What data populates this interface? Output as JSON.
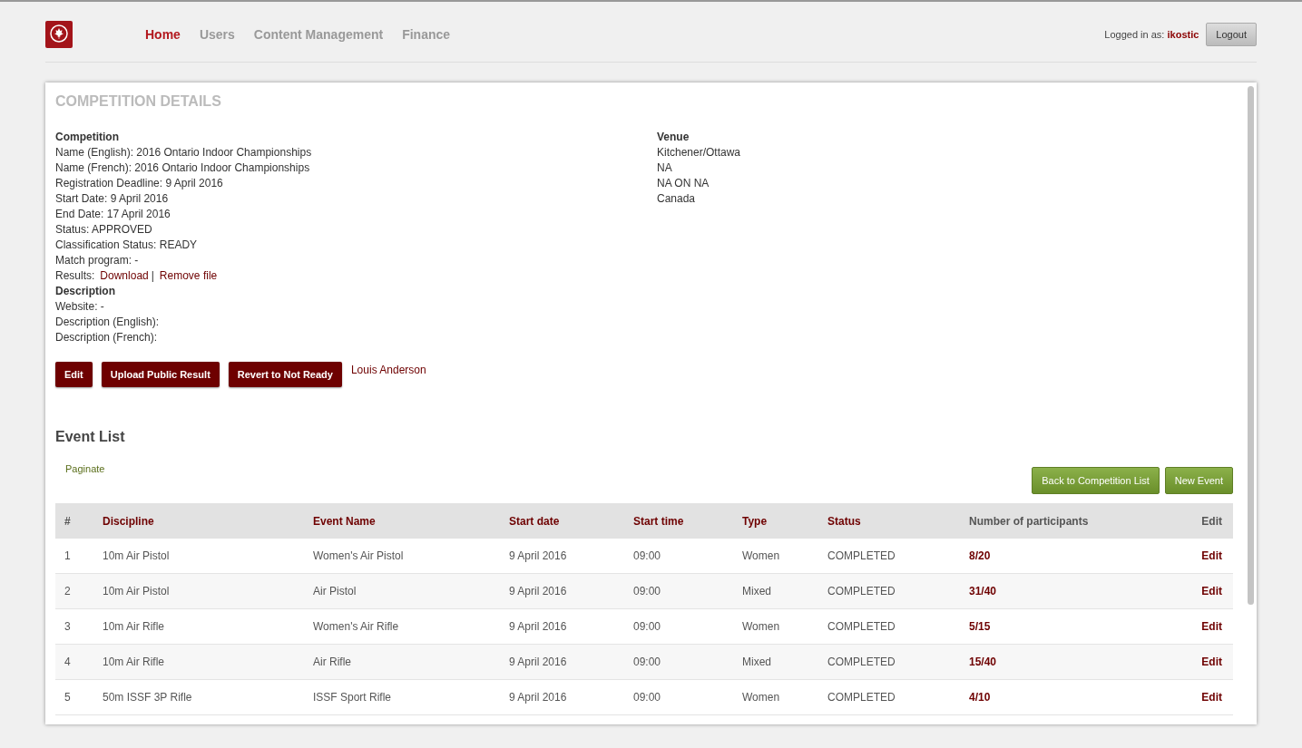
{
  "nav": [
    {
      "label": "Home",
      "selected": true
    },
    {
      "label": "Users",
      "selected": false
    },
    {
      "label": "Content Management",
      "selected": false
    },
    {
      "label": "Finance",
      "selected": false
    }
  ],
  "user": {
    "prefix": "Logged in as:",
    "name": "ikostic",
    "logout": "Logout"
  },
  "panel_title": "COMPETITION DETAILS",
  "details": [
    {
      "kind": "heading",
      "text": "Competition"
    },
    {
      "kind": "line",
      "text": "Name (English): 2016 Ontario Indoor Championships"
    },
    {
      "kind": "line",
      "text": "Name (French): 2016 Ontario Indoor Championships"
    },
    {
      "kind": "line",
      "text": "Registration Deadline: 9 April 2016"
    },
    {
      "kind": "line",
      "text": "Start Date: 9 April 2016"
    },
    {
      "kind": "line",
      "text": "End Date: 17 April 2016"
    },
    {
      "kind": "line",
      "text": "Status: APPROVED"
    },
    {
      "kind": "line",
      "text": "Classification Status: READY"
    },
    {
      "kind": "line",
      "text": "Match program:  -"
    },
    {
      "kind": "links",
      "text": "Results:",
      "links": [
        "Download",
        "Remove file"
      ],
      "separator": "|"
    },
    {
      "kind": "heading",
      "text": "Description"
    },
    {
      "kind": "line",
      "text": "Website:  -"
    },
    {
      "kind": "line",
      "text": "Description (English):"
    },
    {
      "kind": "line",
      "text": "Description (French):"
    }
  ],
  "venue": [
    {
      "kind": "heading",
      "text": "Venue"
    },
    {
      "kind": "line",
      "text": "Kitchener/Ottawa"
    },
    {
      "kind": "line",
      "text": "NA"
    },
    {
      "kind": "line",
      "text": "NA ON NA"
    },
    {
      "kind": "line",
      "text": "Canada"
    }
  ],
  "actions": [
    "Edit",
    "Upload Public Result",
    "Revert to Not Ready"
  ],
  "owner": "Louis Anderson",
  "event_list": {
    "title": "Event List",
    "paginate": "Paginate",
    "buttons": [
      "Back to Competition List",
      "New Event"
    ],
    "columns": [
      {
        "label": "#",
        "sortable": false
      },
      {
        "label": "Discipline",
        "sortable": true
      },
      {
        "label": "Event Name",
        "sortable": true
      },
      {
        "label": "Start date",
        "sortable": true
      },
      {
        "label": "Start time",
        "sortable": true
      },
      {
        "label": "Type",
        "sortable": true
      },
      {
        "label": "Status",
        "sortable": true
      },
      {
        "label": "Number of participants",
        "sortable": false
      },
      {
        "label": "Edit",
        "sortable": false
      }
    ],
    "rows": [
      [
        "1",
        "10m Air Pistol",
        "Women's Air Pistol",
        "9 April 2016",
        "09:00",
        "Women",
        "COMPLETED",
        "8/20",
        "Edit"
      ],
      [
        "2",
        "10m Air Pistol",
        "Air Pistol",
        "9 April 2016",
        "09:00",
        "Mixed",
        "COMPLETED",
        "31/40",
        "Edit"
      ],
      [
        "3",
        "10m Air Rifle",
        "Women's Air Rifle",
        "9 April 2016",
        "09:00",
        "Women",
        "COMPLETED",
        "5/15",
        "Edit"
      ],
      [
        "4",
        "10m Air Rifle",
        "Air Rifle",
        "9 April 2016",
        "09:00",
        "Mixed",
        "COMPLETED",
        "15/40",
        "Edit"
      ],
      [
        "5",
        "50m ISSF 3P Rifle",
        "ISSF Sport Rifle",
        "9 April 2016",
        "09:00",
        "Women",
        "COMPLETED",
        "4/10",
        "Edit"
      ]
    ]
  }
}
